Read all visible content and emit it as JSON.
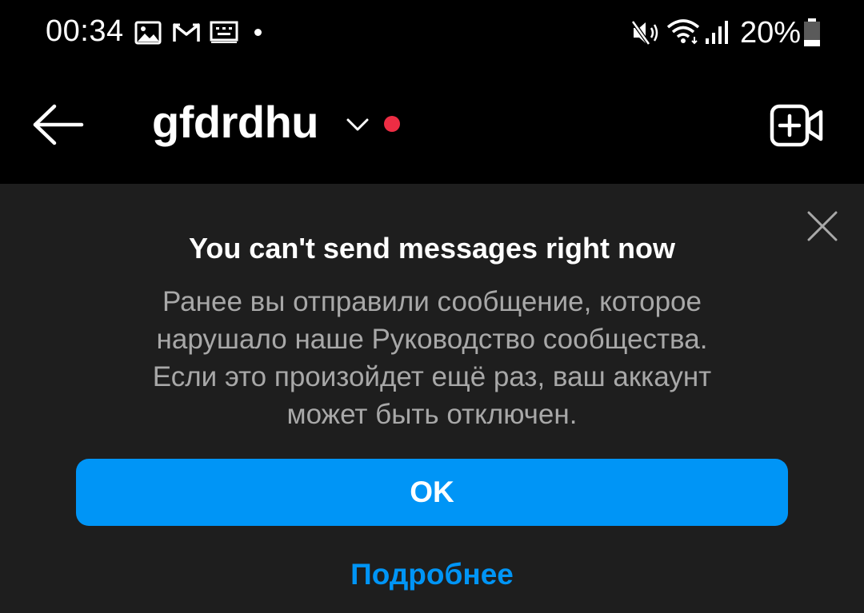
{
  "status_bar": {
    "time": "00:34",
    "battery": "20%",
    "notification_icons": [
      "gallery-icon",
      "gmail-icon",
      "keyboard-icon"
    ],
    "system_icons": [
      "mute-icon",
      "wifi-icon",
      "signal-icon",
      "battery-icon"
    ],
    "battery_level": 0.2
  },
  "header": {
    "username": "gfdrdhu",
    "online_indicator_color": "#ed2d44",
    "back_icon": "arrow-left-icon",
    "dropdown_icon": "chevron-down-icon",
    "video_icon": "add-video-icon"
  },
  "dialog": {
    "title": "You can't send messages right now",
    "body_lines": [
      "Ранее вы отправили сообщение, которое",
      "нарушало наше Руководство сообщества.",
      "Если это произойдет ещё раз, ваш аккаунт",
      "может быть отключен."
    ],
    "ok_label": "OK",
    "learn_more_label": "Подробнее",
    "close_icon": "close-icon",
    "accent_color": "#0095f6"
  }
}
